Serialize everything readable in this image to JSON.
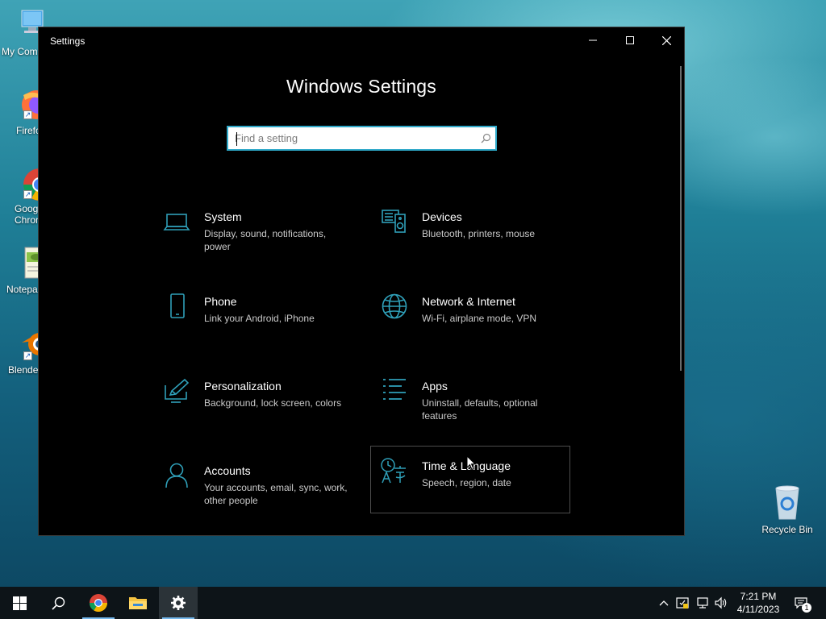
{
  "desktop": {
    "icons": [
      {
        "label": "My Com",
        "icon": "computer-icon"
      },
      {
        "label": "Firefo",
        "icon": "firefox-icon"
      },
      {
        "label": "Goog\nChron",
        "icon": "chrome-icon"
      },
      {
        "label": "Notepa",
        "icon": "notepad-icon"
      },
      {
        "label": "Blende",
        "icon": "blender-icon"
      }
    ],
    "recycle_bin": {
      "label": "Recycle Bin"
    }
  },
  "window": {
    "title": "Settings",
    "heading": "Windows Settings",
    "search": {
      "placeholder": "Find a setting",
      "value": ""
    },
    "tiles": [
      {
        "name": "System",
        "description": "Display, sound, notifications, power",
        "icon": "laptop-icon"
      },
      {
        "name": "Devices",
        "description": "Bluetooth, printers, mouse",
        "icon": "devices-icon"
      },
      {
        "name": "Phone",
        "description": "Link your Android, iPhone",
        "icon": "phone-icon"
      },
      {
        "name": "Network & Internet",
        "description": "Wi-Fi, airplane mode, VPN",
        "icon": "globe-icon"
      },
      {
        "name": "Personalization",
        "description": "Background, lock screen, colors",
        "icon": "personalization-icon"
      },
      {
        "name": "Apps",
        "description": "Uninstall, defaults, optional features",
        "icon": "apps-list-icon"
      },
      {
        "name": "Accounts",
        "description": "Your accounts, email, sync, work, other people",
        "icon": "person-icon"
      },
      {
        "name": "Time & Language",
        "description": "Speech, region, date",
        "icon": "time-language-icon"
      }
    ]
  },
  "taskbar": {
    "clock": {
      "time": "7:21 PM",
      "date": "4/11/2023"
    },
    "notification_count": "1"
  },
  "colors": {
    "accent": "#2fa9c9",
    "icon": "#2f9fb8",
    "window_bg": "#000000",
    "taskbar_bg": "#0d1418"
  }
}
